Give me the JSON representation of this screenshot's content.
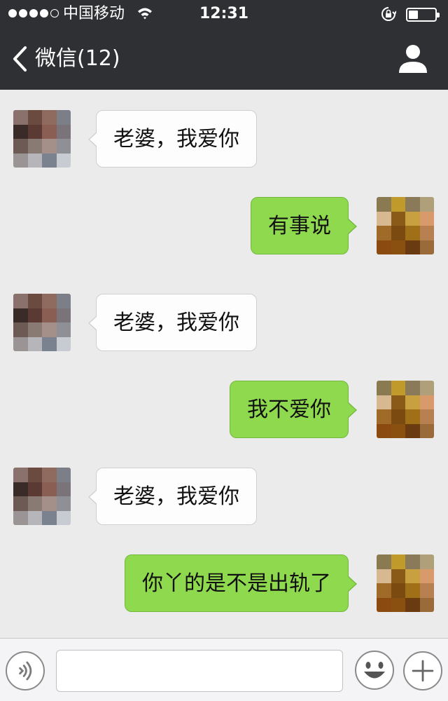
{
  "status_bar": {
    "signal_dots": [
      true,
      true,
      true,
      true,
      false
    ],
    "carrier": "中国移动",
    "time": "12:31",
    "wifi_icon": "wifi-icon",
    "lock_icon": "rotation-lock-icon",
    "battery_level": 0.35
  },
  "nav": {
    "back_label": "微信(12)",
    "back_icon": "chevron-left-icon",
    "profile_icon": "person-icon"
  },
  "messages": [
    {
      "side": "left",
      "text": "老婆，我爱你",
      "avatar": "partner-avatar"
    },
    {
      "side": "right",
      "text": "有事说",
      "avatar": "self-avatar"
    },
    {
      "side": "left",
      "text": "老婆，我爱你",
      "avatar": "partner-avatar"
    },
    {
      "side": "right",
      "text": "我不爱你",
      "avatar": "self-avatar"
    },
    {
      "side": "left",
      "text": "老婆，我爱你",
      "avatar": "partner-avatar"
    },
    {
      "side": "right",
      "text": "你丫的是不是出轨了",
      "avatar": "self-avatar"
    }
  ],
  "input_bar": {
    "voice_icon": "voice-icon",
    "text_value": "",
    "placeholder": "",
    "emoji_icon": "smiley-icon",
    "plus_icon": "plus-icon"
  },
  "colors": {
    "header_bg": "#2e3033",
    "chat_bg": "#ebebeb",
    "bubble_sent": "#8fd94f",
    "bubble_received": "#fdfdfd"
  }
}
